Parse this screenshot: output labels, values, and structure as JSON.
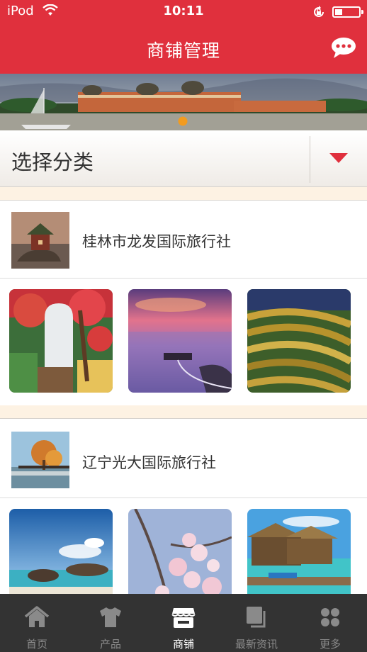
{
  "status_bar": {
    "carrier": "iPod",
    "time": "10:11"
  },
  "header": {
    "title": "商铺管理",
    "message_icon": "chat-bubble-icon"
  },
  "banner": {
    "page_indicator": 1
  },
  "category_select": {
    "label": "选择分类",
    "accent": "#e0303d"
  },
  "shops": [
    {
      "name": "桂林市龙发国际旅行社",
      "thumb_icon": "cabin-on-rock-photo",
      "photos": [
        "mural-photo",
        "lake-sunset-photo",
        "rice-terraces-photo"
      ]
    },
    {
      "name": "辽宁光大国际旅行社",
      "thumb_icon": "autumn-tree-lake-photo",
      "photos": [
        "beach-rocks-photo",
        "cherry-blossom-photo",
        "overwater-bungalow-photo"
      ]
    }
  ],
  "tabbar": {
    "items": [
      {
        "label": "首页",
        "icon": "home-icon",
        "active": false
      },
      {
        "label": "产品",
        "icon": "shirt-icon",
        "active": false
      },
      {
        "label": "商铺",
        "icon": "store-icon",
        "active": true
      },
      {
        "label": "最新资讯",
        "icon": "news-icon",
        "active": false
      },
      {
        "label": "更多",
        "icon": "grid-icon",
        "active": false
      }
    ]
  },
  "colors": {
    "brand": "#e0303d",
    "tabbar": "#333333",
    "separator": "#fdf2e3"
  }
}
